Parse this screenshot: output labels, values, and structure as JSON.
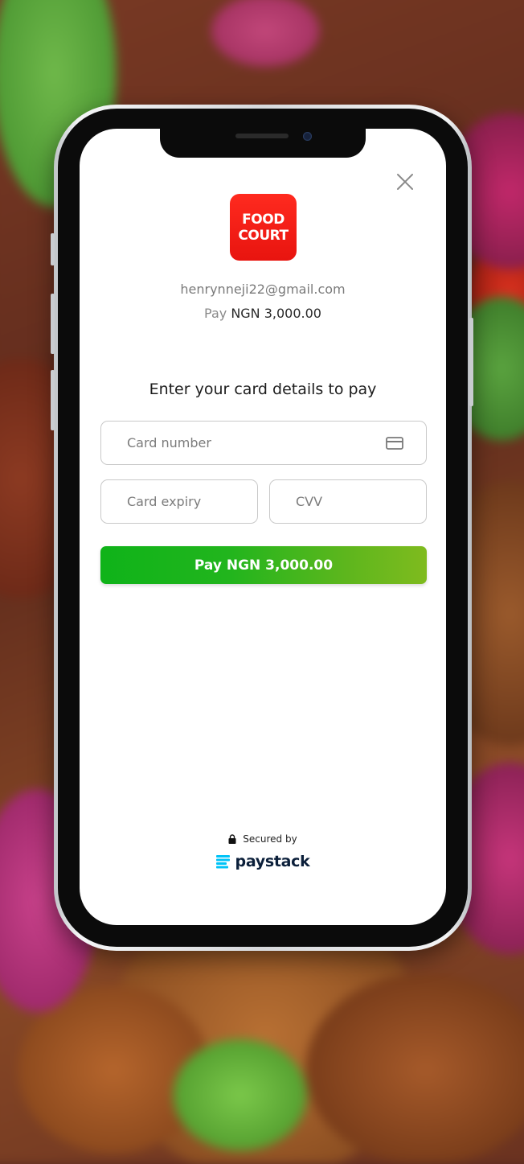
{
  "merchant": {
    "logo_line1": "FOOD",
    "logo_line2": "COURT",
    "logo_color": "#ee1a14"
  },
  "customer": {
    "email": "henrynneji22@gmail.com"
  },
  "payment": {
    "pay_prefix": "Pay",
    "amount": "NGN 3,000.00"
  },
  "form": {
    "heading": "Enter your card details to pay",
    "card_number_placeholder": "Card number",
    "card_expiry_placeholder": "Card expiry",
    "cvv_placeholder": "CVV",
    "pay_button_label": "Pay NGN 3,000.00",
    "pay_button_colors": [
      "#0fb319",
      "#7fbb1e"
    ]
  },
  "footer": {
    "secured_label": "Secured by",
    "brand": "paystack",
    "brand_color": "#0b1f3a",
    "brand_icon_color": "#00c3f7"
  },
  "icons": {
    "close": "close-icon",
    "card": "credit-card-icon",
    "lock": "lock-icon",
    "brand": "paystack-logo-icon"
  }
}
